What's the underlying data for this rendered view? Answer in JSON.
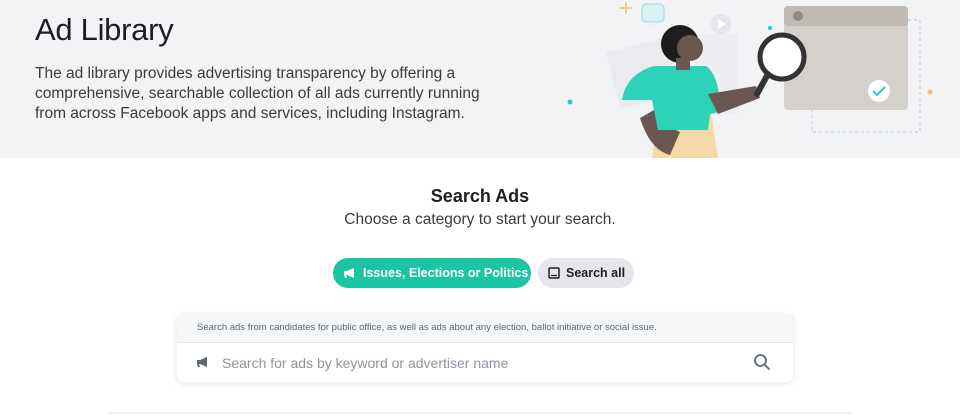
{
  "hero": {
    "title": "Ad Library",
    "description": "The ad library provides advertising transparency by offering a comprehensive, searchable collection of all ads currently running from across Facebook apps and services, including Instagram."
  },
  "search": {
    "heading": "Search Ads",
    "subheading": "Choose a category to start your search.",
    "categories": [
      {
        "label": "Issues, Elections or Politics",
        "icon": "megaphone-icon",
        "selected": true
      },
      {
        "label": "Search all",
        "icon": "tablet-icon",
        "selected": false
      }
    ],
    "hint": "Search ads from candidates for public office, as well as ads about any election, ballot initiative or social issue.",
    "input_placeholder": "Search for ads by keyword or advertiser name",
    "input_value": ""
  },
  "colors": {
    "accent": "#1bc5a3",
    "hero_bg": "#f2f3f5",
    "text_primary": "#1c1e21"
  }
}
